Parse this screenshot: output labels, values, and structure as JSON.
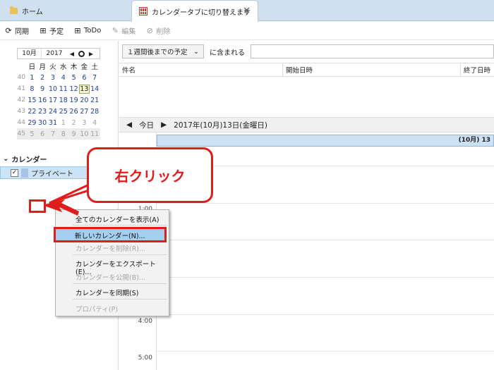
{
  "tabs": [
    {
      "label": "ホーム",
      "icon": "folder-icon"
    },
    {
      "label": "カレンダータブに切り替えます",
      "icon": "calendar-icon",
      "close": "✕"
    }
  ],
  "toolbar": {
    "sync": "同期",
    "event": "予定",
    "todo": "ToDo",
    "edit": "編集",
    "delete": "削除"
  },
  "mini_calendar": {
    "month": "10月",
    "year": "2017",
    "weekdays": [
      "日",
      "月",
      "火",
      "水",
      "木",
      "金",
      "土"
    ],
    "weeks": [
      {
        "wk": "40",
        "days": [
          "1",
          "2",
          "3",
          "4",
          "5",
          "6",
          "7"
        ]
      },
      {
        "wk": "41",
        "days": [
          "8",
          "9",
          "10",
          "11",
          "12",
          "13",
          "14"
        ]
      },
      {
        "wk": "42",
        "days": [
          "15",
          "16",
          "17",
          "18",
          "19",
          "20",
          "21"
        ]
      },
      {
        "wk": "43",
        "days": [
          "22",
          "23",
          "24",
          "25",
          "26",
          "27",
          "28"
        ]
      },
      {
        "wk": "44",
        "days": [
          "29",
          "30",
          "31",
          "1",
          "2",
          "3",
          "4"
        ]
      },
      {
        "wk": "45",
        "days": [
          "5",
          "6",
          "7",
          "8",
          "9",
          "10",
          "11"
        ]
      }
    ],
    "today": "13"
  },
  "calendar_list": {
    "header": "カレンダー",
    "items": [
      {
        "label": "プライベート",
        "checked": "✓",
        "color": "#a9c4e6"
      }
    ]
  },
  "filter": {
    "select": "１週間後までの予定",
    "suffix": "に含まれる"
  },
  "task_columns": [
    "件名",
    "開始日時",
    "終了日時"
  ],
  "day_nav": {
    "today": "今日",
    "date": "2017年(10月)13日(金曜日)"
  },
  "allday_label": "(10月) 13",
  "time_labels": [
    "1:00",
    "4:00",
    "5:00"
  ],
  "context_menu": {
    "items": [
      {
        "label": "全てのカレンダーを表示(A)",
        "enabled": true
      },
      {
        "label": "新しいカレンダー(N)...",
        "enabled": true
      },
      {
        "label": "カレンダーを削除(R)...",
        "enabled": false
      },
      {
        "label": "カレンダーをエクスポート(E)...",
        "enabled": true
      },
      {
        "label": "カレンダーを公開(B)...",
        "enabled": false
      },
      {
        "label": "カレンダーを同期(S)",
        "enabled": true
      },
      {
        "label": "プロパティ(P)",
        "enabled": false
      }
    ]
  },
  "annotation": {
    "callout": "右クリック",
    "color": "#e01c1c"
  }
}
